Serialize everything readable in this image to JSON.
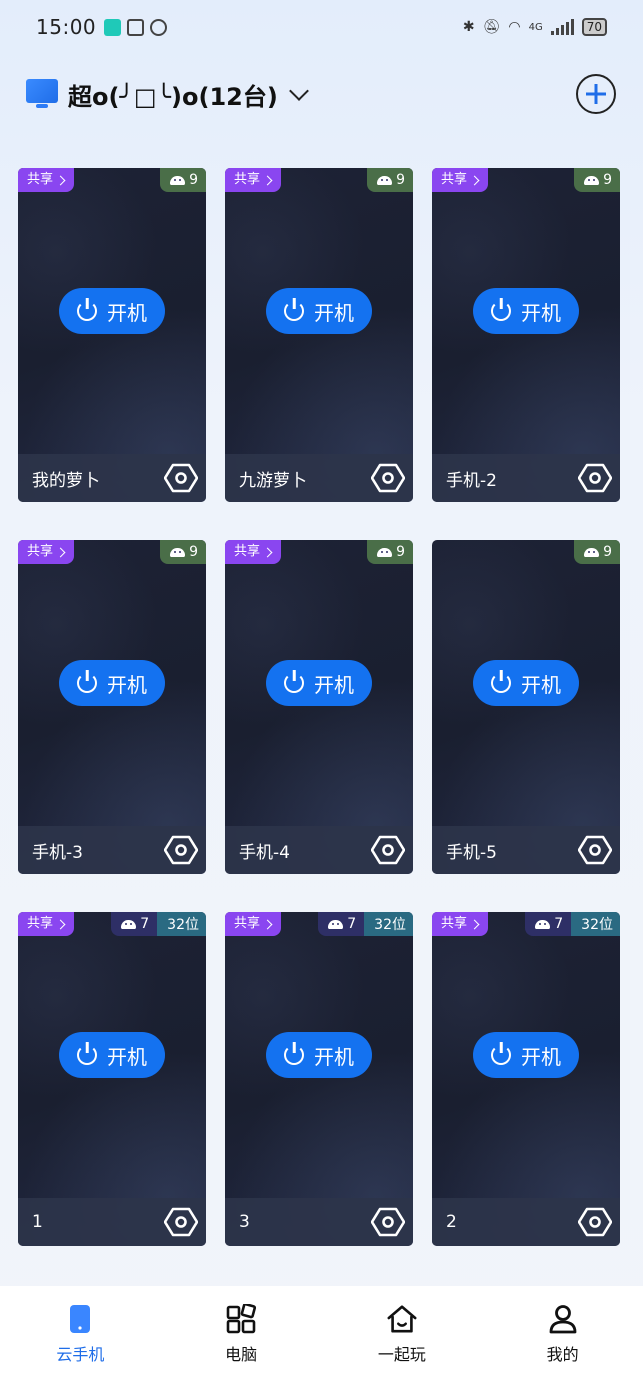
{
  "status_bar": {
    "time": "15:00",
    "network_label": "4G",
    "battery": "70"
  },
  "header": {
    "title": "超o(╯□╰)o(12台)"
  },
  "card_common": {
    "share_label": "共享",
    "power_label": "开机"
  },
  "cards": [
    {
      "name": "我的萝卜",
      "shared": true,
      "android": "9",
      "bits": ""
    },
    {
      "name": "九游萝卜",
      "shared": true,
      "android": "9",
      "bits": ""
    },
    {
      "name": "手机-2",
      "shared": true,
      "android": "9",
      "bits": ""
    },
    {
      "name": "手机-3",
      "shared": true,
      "android": "9",
      "bits": ""
    },
    {
      "name": "手机-4",
      "shared": true,
      "android": "9",
      "bits": ""
    },
    {
      "name": "手机-5",
      "shared": false,
      "android": "9",
      "bits": ""
    },
    {
      "name": "1",
      "shared": true,
      "android": "7",
      "bits": "32位"
    },
    {
      "name": "3",
      "shared": true,
      "android": "7",
      "bits": "32位"
    },
    {
      "name": "2",
      "shared": true,
      "android": "7",
      "bits": "32位"
    }
  ],
  "bottom_nav": [
    {
      "label": "云手机",
      "icon": "phone-icon",
      "active": true
    },
    {
      "label": "电脑",
      "icon": "windows-icon",
      "active": false
    },
    {
      "label": "一起玩",
      "icon": "home-icon",
      "active": false
    },
    {
      "label": "我的",
      "icon": "user-icon",
      "active": false
    }
  ],
  "colors": {
    "accent": "#1f6de8",
    "share_badge": "#8a46f0",
    "android9_badge": "#4a6e48",
    "android7_badge": "#2e2f66",
    "bit_badge": "#2a6a82",
    "card_bg": "#1d2235"
  }
}
